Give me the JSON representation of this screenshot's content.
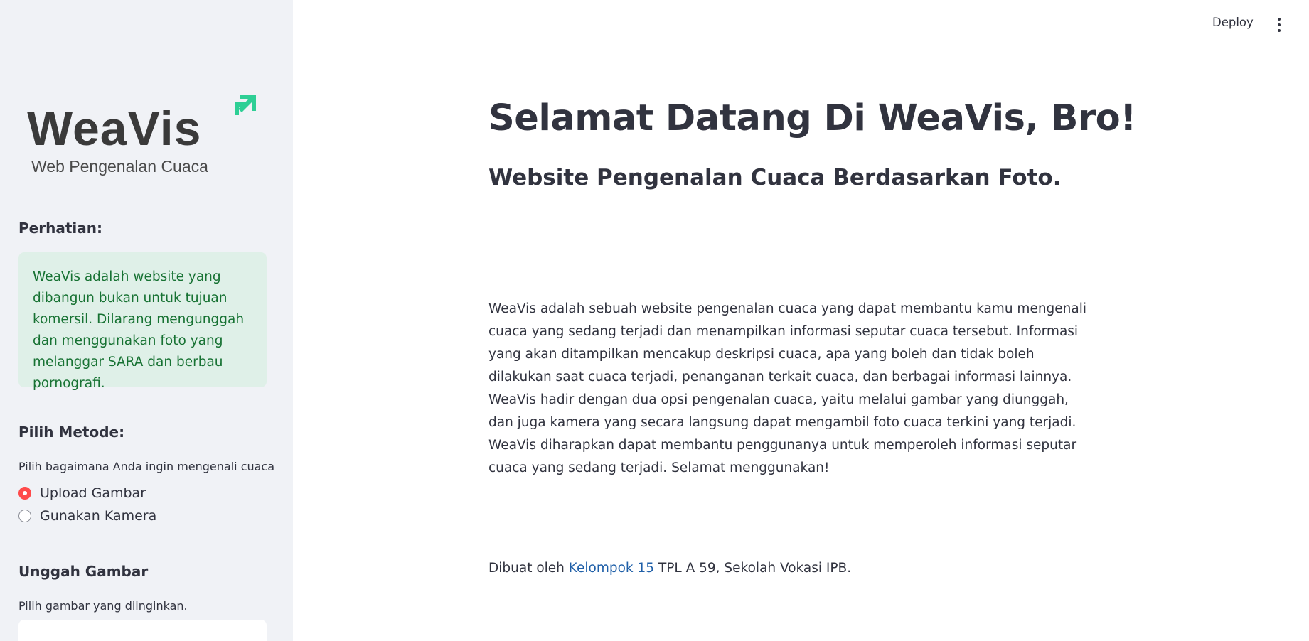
{
  "toolbar": {
    "deploy_label": "Deploy",
    "menu_icon": "kebab-menu-icon"
  },
  "sidebar": {
    "logo": {
      "wordmark": "WeaVis",
      "tagline": "Web Pengenalan Cuaca",
      "accent_color": "#2ecf95"
    },
    "notice_heading": "Perhatian:",
    "notice_text": "WeaVis adalah website yang dibangun bukan untuk tujuan komersil. Dilarang mengunggah dan menggunakan foto yang melanggar SARA dan berbau pornografi.",
    "method_heading": "Pilih Metode:",
    "method_caption": "Pilih bagaimana Anda ingin mengenali cuaca",
    "method_options": [
      {
        "label": "Upload Gambar",
        "selected": true
      },
      {
        "label": "Gunakan Kamera",
        "selected": false
      }
    ],
    "upload_heading": "Unggah Gambar",
    "upload_caption": "Pilih gambar yang diinginkan."
  },
  "main": {
    "title": "Selamat Datang Di WeaVis, Bro!",
    "subtitle": "Website Pengenalan Cuaca Berdasarkan Foto.",
    "description": "WeaVis adalah sebuah website pengenalan cuaca yang dapat membantu kamu mengenali cuaca yang sedang terjadi dan menampilkan informasi seputar cuaca tersebut. Informasi yang akan ditampilkan mencakup deskripsi cuaca, apa yang boleh dan tidak boleh dilakukan saat cuaca terjadi, penanganan terkait cuaca, dan berbagai informasi lainnya. WeaVis hadir dengan dua opsi pengenalan cuaca, yaitu melalui gambar yang diunggah, dan juga kamera yang secara langsung dapat mengambil foto cuaca terkini yang terjadi. WeaVis diharapkan dapat membantu penggunanya untuk memperoleh informasi seputar cuaca yang sedang terjadi. Selamat menggunakan!",
    "footer": {
      "prefix": "Dibuat oleh ",
      "link_text": "Kelompok 15",
      "suffix": " TPL A 59, Sekolah Vokasi IPB."
    }
  },
  "colors": {
    "accent_red": "#ff4b4b",
    "notice_bg": "#dff0e8",
    "notice_text": "#177233",
    "sidebar_bg": "#f0f2f6"
  }
}
